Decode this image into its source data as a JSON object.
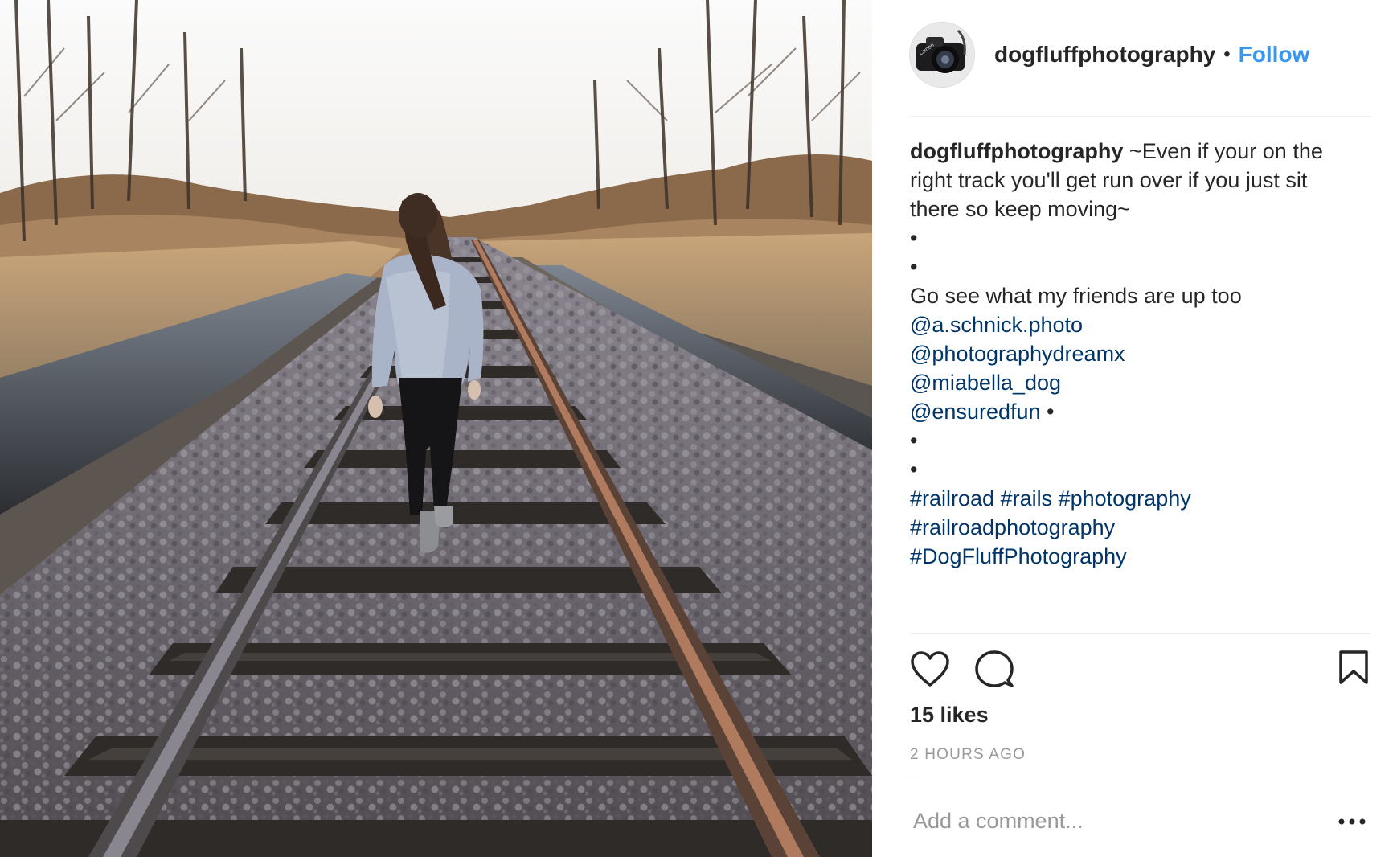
{
  "post": {
    "photo_icon": "railroad-photo",
    "author": {
      "avatar_icon": "camera-avatar-icon",
      "username": "dogfluffphotography",
      "separator": "•",
      "follow_label": "Follow"
    },
    "caption": {
      "username": "dogfluffphotography",
      "lines": [
        "~Even if your on the",
        "right track you'll get run over if you just sit",
        "there so keep moving~",
        "•",
        "•",
        "Go see what my friends are up too"
      ],
      "mentions": [
        "@a.schnick.photo",
        "@photographydreamx",
        "@miabella_dog",
        "@ensuredfun"
      ],
      "mention_suffix": " •",
      "bullets_after_mentions": [
        "•",
        "•"
      ],
      "hashtags": [
        "#railroad #rails #photography",
        "#railroadphotography",
        "#DogFluffPhotography"
      ]
    },
    "actions": {
      "like_icon": "heart-icon",
      "comment_icon": "comment-icon",
      "save_icon": "bookmark-icon"
    },
    "likes_label": "15 likes",
    "timestamp": "2 HOURS AGO",
    "comment": {
      "placeholder": "Add a comment...",
      "value": ""
    },
    "more_icon": "more-options-icon",
    "colors": {
      "link": "#003569",
      "follow": "#3897f0",
      "muted": "#999999",
      "text": "#262626"
    }
  }
}
